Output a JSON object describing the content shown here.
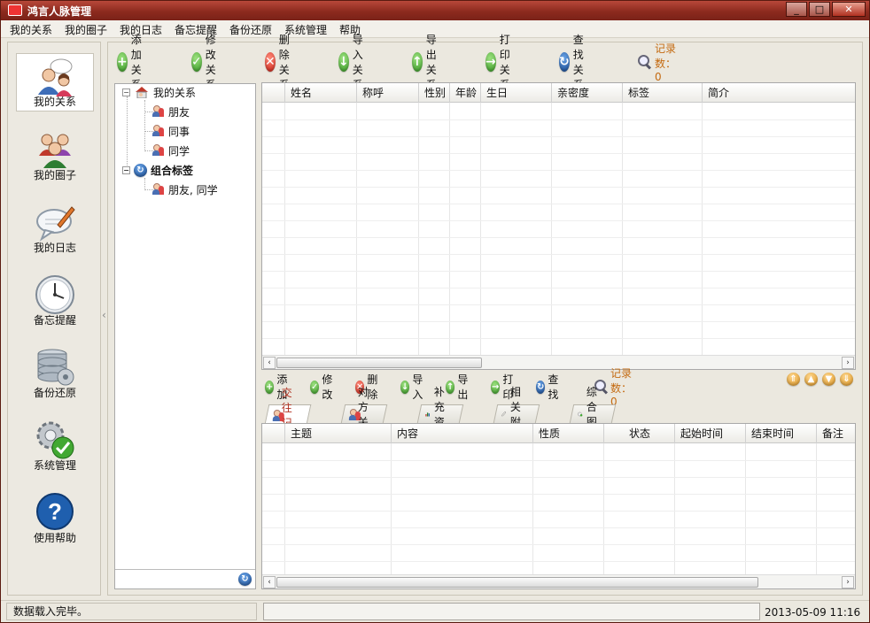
{
  "window": {
    "title": "鸿言人脉管理",
    "minimize": "_",
    "maximize": "□",
    "close": "✕"
  },
  "menu": [
    "我的关系",
    "我的圈子",
    "我的日志",
    "备忘提醒",
    "备份还原",
    "系统管理",
    "帮助"
  ],
  "leftnav": [
    {
      "label": "我的关系",
      "icon": "people-chat-icon",
      "active": true
    },
    {
      "label": "我的圈子",
      "icon": "group-icon"
    },
    {
      "label": "我的日志",
      "icon": "speech-bubble-pen-icon"
    },
    {
      "label": "备忘提醒",
      "icon": "clock-icon"
    },
    {
      "label": "备份还原",
      "icon": "database-icon"
    },
    {
      "label": "系统管理",
      "icon": "gear-check-icon"
    },
    {
      "label": "使用帮助",
      "icon": "help-icon"
    }
  ],
  "toolbar": {
    "add": "添加关系",
    "edit": "修改关系",
    "delete": "删除关系",
    "import": "导入关系",
    "export": "导出关系",
    "print": "打印关系",
    "find": "查找关系",
    "record_count": "记录数：0"
  },
  "tree": {
    "root": "我的关系",
    "children": [
      "朋友",
      "同事",
      "同学"
    ],
    "combo": "组合标签",
    "combo_children": [
      "朋友, 同学"
    ]
  },
  "main_grid": {
    "columns": [
      "姓名",
      "称呼",
      "性别",
      "年龄",
      "生日",
      "亲密度",
      "标签",
      "简介"
    ]
  },
  "subtoolbar": {
    "add": "添加",
    "edit": "修改",
    "delete": "删除",
    "import": "导入",
    "export": "导出",
    "print": "打印",
    "find": "查找",
    "record_count": "记录数：0"
  },
  "tabs": [
    "交往记录",
    "对方关系",
    "补充资料",
    "相关附件",
    "综合图表"
  ],
  "detail_grid": {
    "columns": [
      "主题",
      "内容",
      "性质",
      "状态",
      "起始时间",
      "结束时间",
      "备注"
    ]
  },
  "status": {
    "message": "数据载入完毕。",
    "datetime": "2013-05-09 11:16"
  },
  "colors": {
    "titlebar": "#8c2a1e",
    "accent": "#c46a10",
    "active_tab": "#b03020"
  }
}
